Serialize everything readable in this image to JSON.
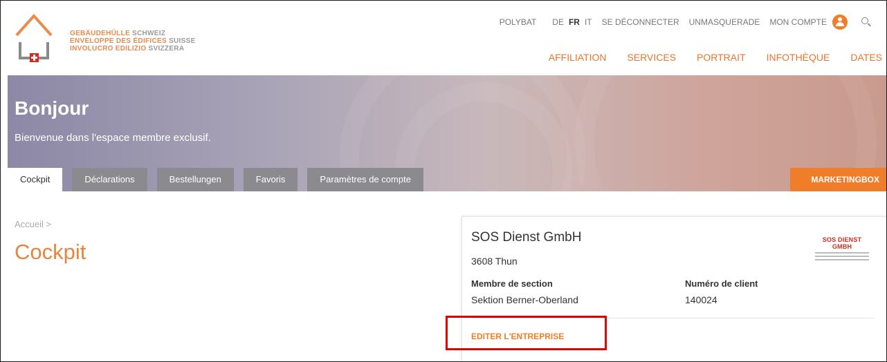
{
  "logo": {
    "lines": [
      {
        "bold": "GEBÄUDEHÜLLE",
        "light": "SCHWEIZ"
      },
      {
        "bold": "ENVELOPPE DES ÉDIFICES",
        "light": "SUISSE"
      },
      {
        "bold": "INVOLUCRO EDILIZIO",
        "light": "SVIZZERA"
      }
    ]
  },
  "topnav": {
    "polybat": "POLYBAT",
    "languages": [
      "DE",
      "FR",
      "IT"
    ],
    "active_language": "FR",
    "logout": "SE DÉCONNECTER",
    "unmasquerade": "UNMASQUERADE",
    "account": "MON COMPTE"
  },
  "mainnav": [
    "AFFILIATION",
    "SERVICES",
    "PORTRAIT",
    "INFOTHÈQUE",
    "DATES"
  ],
  "hero": {
    "title": "Bonjour",
    "subtitle": "Bienvenue dans l'espace membre exclusif."
  },
  "tabs": [
    "Cockpit",
    "Déclarations",
    "Bestellungen",
    "Favoris",
    "Paramètres de compte"
  ],
  "marketingbox": "MARKETINGBOX",
  "breadcrumb": "Accueil >",
  "page_title": "Cockpit",
  "company": {
    "name": "SOS Dienst GmbH",
    "city": "3608 Thun",
    "section_label": "Membre de section",
    "section_value": "Sektion Berner-Oberland",
    "client_label": "Numéro de client",
    "client_value": "140024",
    "edit_label": "EDITER L'ENTREPRISE",
    "logo_text": "SOS DIENST GMBH"
  },
  "colors": {
    "accent": "#f07d2a",
    "highlight": "#e30000"
  }
}
